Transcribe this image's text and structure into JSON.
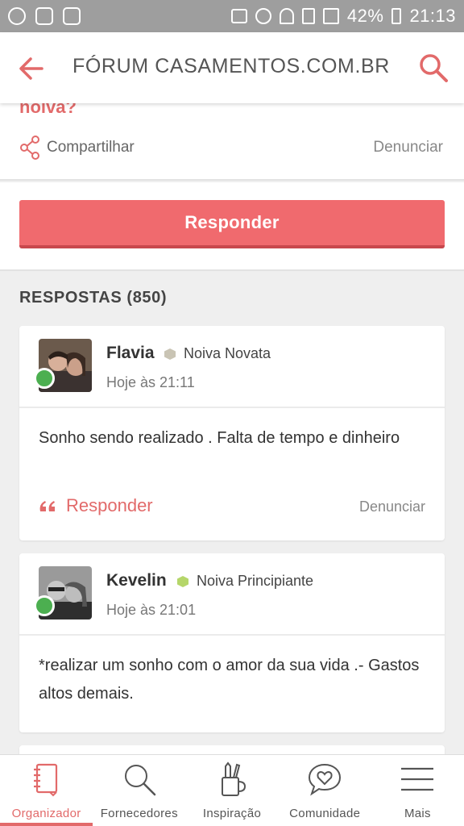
{
  "status_bar": {
    "battery": "42%",
    "time": "21:13",
    "left_icons": [
      "whatsapp-icon",
      "gallery-icon",
      "outlook-icon"
    ],
    "right_icons": [
      "mute-icon",
      "alarm-icon",
      "wifi-icon",
      "sim-icon",
      "signal-icon",
      "battery-icon"
    ]
  },
  "header": {
    "title": "FÓRUM CASAMENTOS.COM.BR",
    "back_icon": "arrow-left-icon",
    "search_icon": "search-icon"
  },
  "post": {
    "title_fragment": "noiva?",
    "share_label": "Compartilhar",
    "report_label": "Denunciar"
  },
  "reply_button": "Responder",
  "responses": {
    "title": "RESPOSTAS (850)",
    "items": [
      {
        "name": "Flavia",
        "rank": "Noiva Novata",
        "rank_color": "#c9c4b4",
        "time": "Hoje às 21:11",
        "body": "Sonho sendo realizado . Falta de tempo e dinheiro",
        "reply_label": "Responder",
        "report_label": "Denunciar"
      },
      {
        "name": "Kevelin",
        "rank": "Noiva Principiante",
        "rank_color": "#b5d66a",
        "time": "Hoje às 21:01",
        "body": "*realizar um sonho com o amor da sua vida .- Gastos altos demais."
      }
    ]
  },
  "bottom_nav": [
    {
      "label": "Organizador",
      "icon": "notebook-icon",
      "active": true
    },
    {
      "label": "Fornecedores",
      "icon": "search-icon",
      "active": false
    },
    {
      "label": "Inspiração",
      "icon": "pencil-cup-icon",
      "active": false
    },
    {
      "label": "Comunidade",
      "icon": "chat-heart-icon",
      "active": false
    },
    {
      "label": "Mais",
      "icon": "menu-icon",
      "active": false
    }
  ],
  "colors": {
    "accent": "#e26a6a",
    "button": "#f06a6e",
    "online": "#4caf50"
  }
}
